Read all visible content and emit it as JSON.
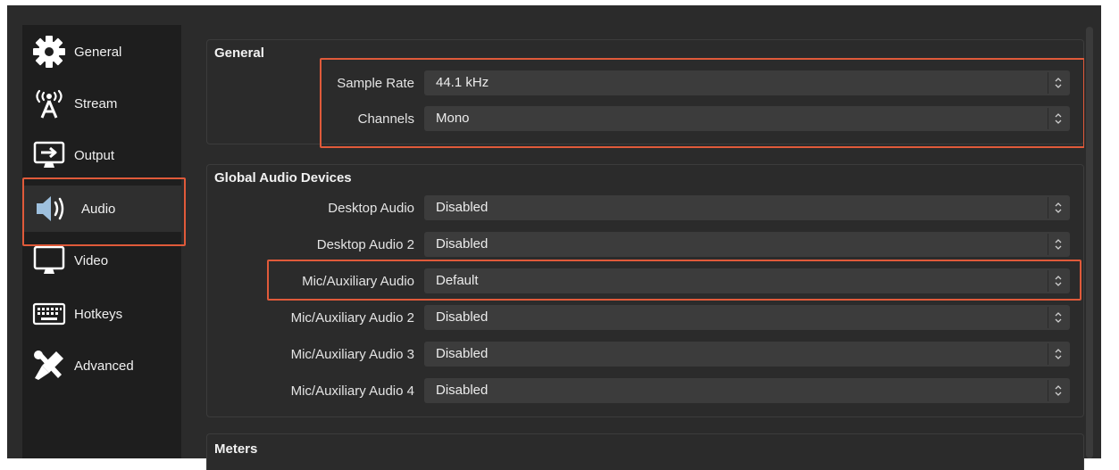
{
  "sidebar": {
    "items": [
      {
        "label": "General",
        "icon": "gear-icon"
      },
      {
        "label": "Stream",
        "icon": "broadcast-antenna-icon"
      },
      {
        "label": "Output",
        "icon": "output-monitor-icon"
      },
      {
        "label": "Audio",
        "icon": "speaker-icon"
      },
      {
        "label": "Video",
        "icon": "monitor-icon"
      },
      {
        "label": "Hotkeys",
        "icon": "keyboard-icon"
      },
      {
        "label": "Advanced",
        "icon": "tools-icon"
      }
    ],
    "selected": "Audio"
  },
  "general": {
    "title": "General",
    "sample_rate_label": "Sample Rate",
    "sample_rate_value": "44.1 kHz",
    "channels_label": "Channels",
    "channels_value": "Mono"
  },
  "devices": {
    "title": "Global Audio Devices",
    "rows": [
      {
        "label": "Desktop Audio",
        "value": "Disabled"
      },
      {
        "label": "Desktop Audio 2",
        "value": "Disabled"
      },
      {
        "label": "Mic/Auxiliary Audio",
        "value": "Default"
      },
      {
        "label": "Mic/Auxiliary Audio 2",
        "value": "Disabled"
      },
      {
        "label": "Mic/Auxiliary Audio 3",
        "value": "Disabled"
      },
      {
        "label": "Mic/Auxiliary Audio 4",
        "value": "Disabled"
      }
    ]
  },
  "meters": {
    "title": "Meters"
  },
  "colors": {
    "highlight": "#e05a3a",
    "background": "#2b2b2b",
    "sidebar": "#1e1e1e",
    "field": "#3c3c3c"
  }
}
